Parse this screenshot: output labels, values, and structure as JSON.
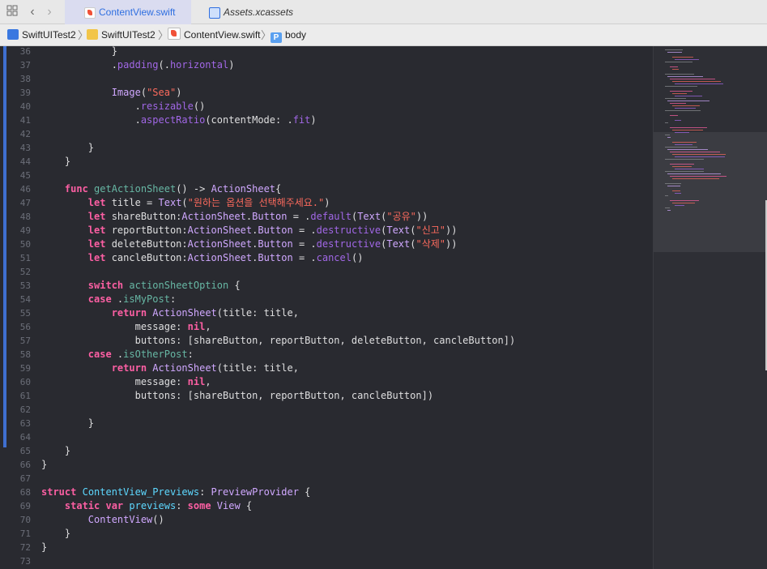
{
  "tabs": [
    {
      "label": "ContentView.swift",
      "active": true,
      "icon": "swift-file-icon"
    },
    {
      "label": "Assets.xcassets",
      "active": false,
      "icon": "asset-catalog-icon"
    }
  ],
  "breadcrumb": [
    "SwiftUITest2",
    "SwiftUITest2",
    "ContentView.swift",
    "body"
  ],
  "code_lines": [
    {
      "n": "36",
      "html": "            }"
    },
    {
      "n": "37",
      "html": "            .<span class=\"mem\">padding</span>(.<span class=\"mem\">horizontal</span>)"
    },
    {
      "n": "38",
      "html": ""
    },
    {
      "n": "39",
      "html": "            <span class=\"ty\">Image</span>(<span class=\"str\">\"Sea\"</span>)"
    },
    {
      "n": "40",
      "html": "                .<span class=\"mem\">resizable</span>()"
    },
    {
      "n": "41",
      "html": "                .<span class=\"mem\">aspectRatio</span>(contentMode: .<span class=\"mem\">fit</span>)"
    },
    {
      "n": "42",
      "html": ""
    },
    {
      "n": "43",
      "html": "        }"
    },
    {
      "n": "44",
      "html": "    }"
    },
    {
      "n": "45",
      "html": ""
    },
    {
      "n": "46",
      "html": "    <span class=\"kw\">func</span> <span class=\"fn\">getActionSheet</span>() -> <span class=\"ty\">ActionSheet</span>{"
    },
    {
      "n": "47",
      "html": "        <span class=\"kw\">let</span> title = <span class=\"ty\">Text</span>(<span class=\"str\">\"원하는 옵션을 선택해주세요.\"</span>)"
    },
    {
      "n": "48",
      "html": "        <span class=\"kw\">let</span> shareButton:<span class=\"ty\">ActionSheet</span>.<span class=\"ty\">Button</span> = .<span class=\"mem\">default</span>(<span class=\"ty\">Text</span>(<span class=\"str\">\"공유\"</span>))"
    },
    {
      "n": "49",
      "html": "        <span class=\"kw\">let</span> reportButton:<span class=\"ty\">ActionSheet</span>.<span class=\"ty\">Button</span> = .<span class=\"mem\">destructive</span>(<span class=\"ty\">Text</span>(<span class=\"str\">\"신고\"</span>))"
    },
    {
      "n": "50",
      "html": "        <span class=\"kw\">let</span> deleteButton:<span class=\"ty\">ActionSheet</span>.<span class=\"ty\">Button</span> = .<span class=\"mem\">destructive</span>(<span class=\"ty\">Text</span>(<span class=\"str\">\"삭제\"</span>))"
    },
    {
      "n": "51",
      "html": "        <span class=\"kw\">let</span> cancleButton:<span class=\"ty\">ActionSheet</span>.<span class=\"ty\">Button</span> = .<span class=\"mem\">cancel</span>()"
    },
    {
      "n": "52",
      "html": ""
    },
    {
      "n": "53",
      "html": "        <span class=\"kw\">switch</span> <span class=\"fn\">actionSheetOption</span> {"
    },
    {
      "n": "54",
      "html": "        <span class=\"kw\">case</span> .<span class=\"fn\">isMyPost</span>:"
    },
    {
      "n": "55",
      "html": "            <span class=\"kw\">return</span> <span class=\"ty\">ActionSheet</span>(title: title,"
    },
    {
      "n": "56",
      "html": "                message: <span class=\"kw\">nil</span>,"
    },
    {
      "n": "57",
      "html": "                buttons: [shareButton, reportButton, deleteButton, cancleButton])"
    },
    {
      "n": "58",
      "html": "        <span class=\"kw\">case</span> .<span class=\"fn\">isOtherPost</span>:"
    },
    {
      "n": "59",
      "html": "            <span class=\"kw\">return</span> <span class=\"ty\">ActionSheet</span>(title: title,"
    },
    {
      "n": "60",
      "html": "                message: <span class=\"kw\">nil</span>,"
    },
    {
      "n": "61",
      "html": "                buttons: [shareButton, reportButton, cancleButton])"
    },
    {
      "n": "62",
      "html": ""
    },
    {
      "n": "63",
      "html": "        }"
    },
    {
      "n": "64",
      "html": ""
    },
    {
      "n": "65",
      "html": "    }"
    },
    {
      "n": "66",
      "html": "}"
    },
    {
      "n": "67",
      "html": ""
    },
    {
      "n": "68",
      "html": "<span class=\"kw\">struct</span> <span class=\"tdecl\">ContentView_Previews</span>: <span class=\"ty\">PreviewProvider</span> {"
    },
    {
      "n": "69",
      "html": "    <span class=\"kw\">static var</span> <span class=\"tdecl\">previews</span>: <span class=\"kw\">some</span> <span class=\"ty\">View</span> {"
    },
    {
      "n": "70",
      "html": "        <span class=\"ty\">ContentView</span>()"
    },
    {
      "n": "71",
      "html": "    }"
    },
    {
      "n": "72",
      "html": "}"
    },
    {
      "n": "73",
      "html": ""
    }
  ],
  "colors": {
    "keyword": "#fc5fa3",
    "type": "#d0a8ff",
    "string": "#fc6a5d",
    "member": "#a167e6",
    "decl": "#67b7a4",
    "change_bar": "#3f6fd0"
  }
}
